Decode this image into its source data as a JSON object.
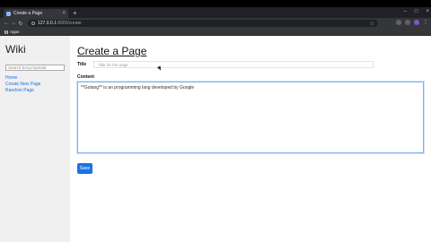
{
  "browser": {
    "tab_title": "Create a Page",
    "tab_close": "×",
    "new_tab": "+",
    "url_host": "127.0.0.1",
    "url_rest": ":8000/create",
    "bookmark_apps": "Apps",
    "window_controls": [
      "–",
      "□",
      "×"
    ]
  },
  "sidebar": {
    "title": "Wiki",
    "search_placeholder": "Search Encyclopedia",
    "links": [
      "Home",
      "Create New Page",
      "Random Page"
    ]
  },
  "form": {
    "heading": "Create a Page",
    "title_label": "Title",
    "title_placeholder": "Title for the page",
    "content_label": "Content",
    "content_value": "**Golang** is an programming lang developed by Google",
    "save_label": "Save"
  }
}
